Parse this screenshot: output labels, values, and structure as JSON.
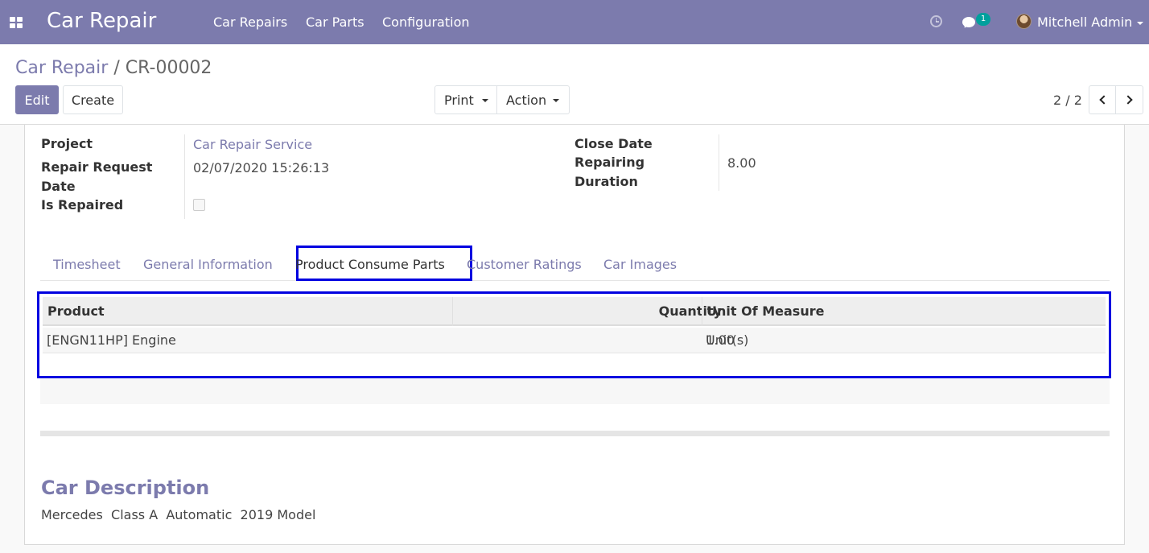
{
  "navbar": {
    "brand": "Car Repair",
    "menu": [
      "Car Repairs",
      "Car Parts",
      "Configuration"
    ],
    "message_count": "1",
    "user_name": "Mitchell Admin",
    "bg_color": "#7c7bad"
  },
  "control_panel": {
    "breadcrumb_parent": "Car Repair",
    "breadcrumb_separator": "/",
    "breadcrumb_current": "CR-00002",
    "edit_label": "Edit",
    "create_label": "Create",
    "print_label": "Print",
    "action_label": "Action",
    "pager": "2 / 2"
  },
  "form": {
    "project_label": "Project",
    "project_value": "Car Repair Service",
    "repair_request_label_line1": "Repair Request",
    "repair_request_label_line2": "Date",
    "repair_request_value": "02/07/2020 15:26:13",
    "is_repaired_label": "Is Repaired",
    "is_repaired_value": false,
    "close_date_label": "Close Date",
    "repairing_duration_label_line1": "Repairing",
    "repairing_duration_label_line2": "Duration",
    "repairing_duration_value": "8.00"
  },
  "tabs": {
    "items": [
      "Timesheet",
      "General Information",
      "Product Consume Parts",
      "Customer Ratings",
      "Car Images"
    ],
    "active": "Product Consume Parts"
  },
  "parts_table": {
    "columns": [
      "Product",
      "Quantity",
      "Unit Of Measure"
    ],
    "rows": [
      {
        "product": "[ENGN11HP] Engine",
        "quantity": "1.00",
        "uom": "Unit(s)"
      }
    ]
  },
  "description": {
    "title": "Car Description",
    "text": "Mercedes  Class A  Automatic  2019 Model"
  },
  "highlight_color": "#0000e0"
}
